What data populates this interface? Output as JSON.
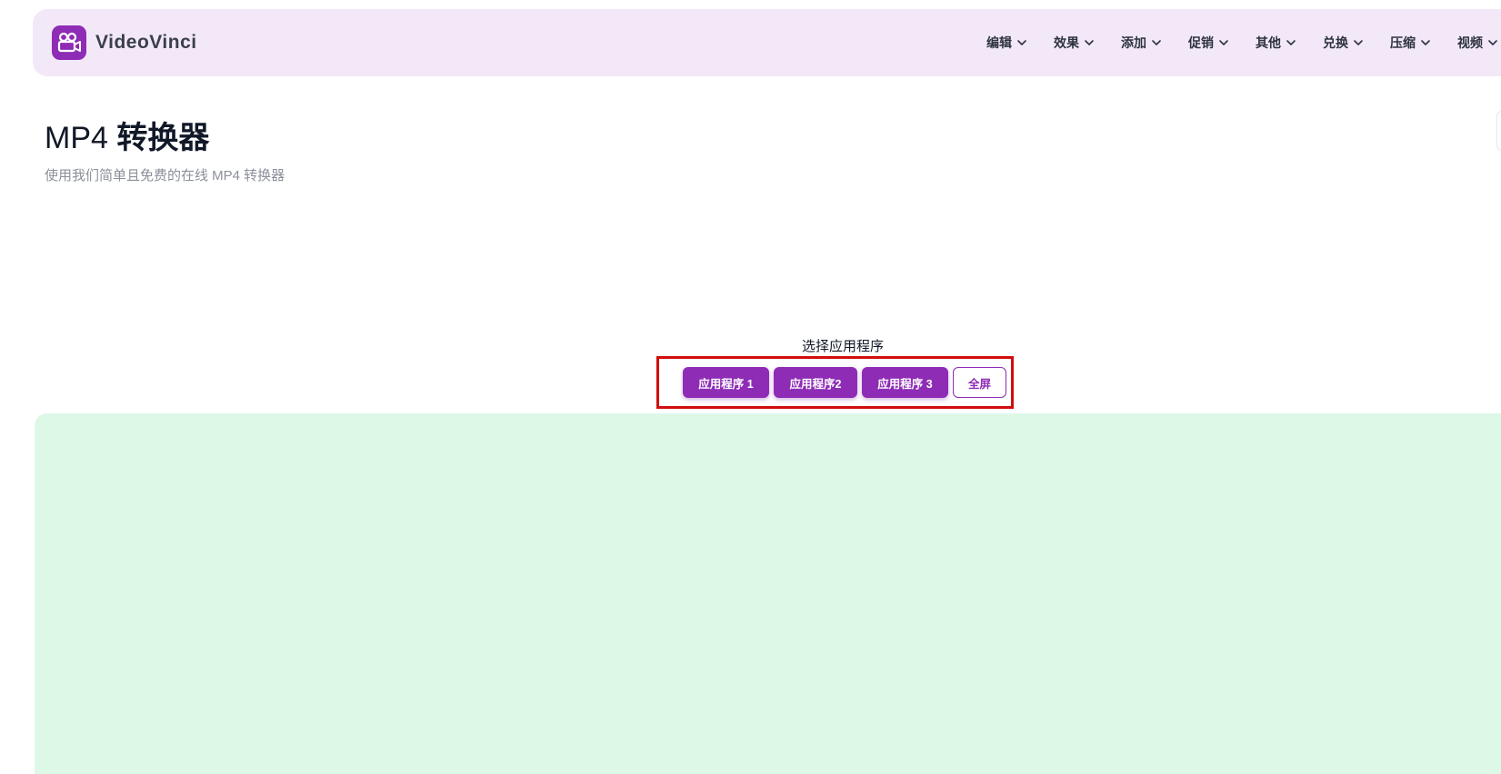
{
  "header": {
    "logo_text": "VideoVinci",
    "logo_icon": "video-camera-icon",
    "nav": [
      {
        "label": "编辑",
        "icon": "chevron-down-icon"
      },
      {
        "label": "效果",
        "icon": "chevron-down-icon"
      },
      {
        "label": "添加",
        "icon": "chevron-down-icon"
      },
      {
        "label": "促销",
        "icon": "chevron-down-icon"
      },
      {
        "label": "其他",
        "icon": "chevron-down-icon"
      },
      {
        "label": "兑换",
        "icon": "chevron-down-icon"
      },
      {
        "label": "压缩",
        "icon": "chevron-down-icon"
      },
      {
        "label": "视频",
        "icon": "chevron-down-icon"
      }
    ]
  },
  "main": {
    "title_prefix": "MP4 ",
    "title_bold": "转换器",
    "subtitle": "使用我们简单且免费的在线 MP4 转换器"
  },
  "app_selector": {
    "label": "选择应用程序",
    "buttons": [
      {
        "label": "应用程序 1"
      },
      {
        "label": "应用程序2"
      },
      {
        "label": "应用程序 3"
      }
    ],
    "fullscreen_label": "全屏"
  },
  "colors": {
    "accent": "#8e2cb6",
    "header_bg": "#f3e8f8",
    "workspace_bg": "#def8e8",
    "highlight_border": "#d10d0d"
  }
}
